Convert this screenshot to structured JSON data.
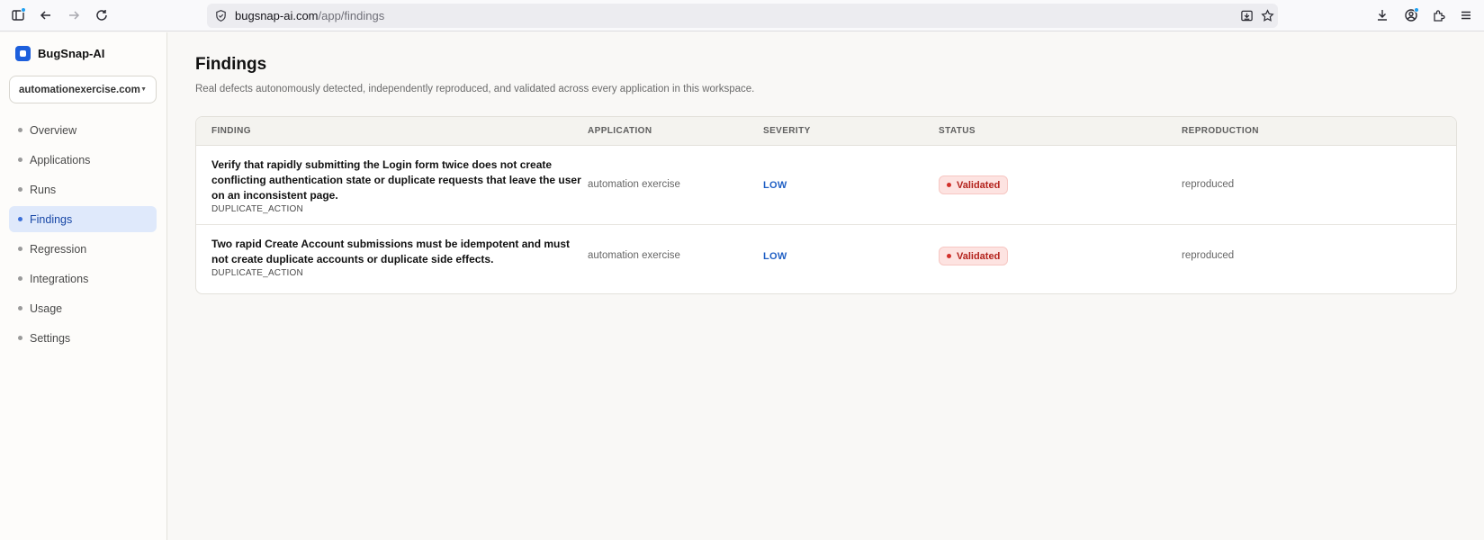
{
  "browser": {
    "url_host": "bugsnap-ai.com",
    "url_path": "/app/findings"
  },
  "sidebar": {
    "brand": "BugSnap-AI",
    "workspace": "automationexercise.com",
    "items": [
      {
        "label": "Overview",
        "active": false
      },
      {
        "label": "Applications",
        "active": false
      },
      {
        "label": "Runs",
        "active": false
      },
      {
        "label": "Findings",
        "active": true
      },
      {
        "label": "Regression",
        "active": false
      },
      {
        "label": "Integrations",
        "active": false
      },
      {
        "label": "Usage",
        "active": false
      },
      {
        "label": "Settings",
        "active": false
      }
    ]
  },
  "main": {
    "title": "Findings",
    "subtitle": "Real defects autonomously detected, independently reproduced, and validated across every application in this workspace.",
    "table": {
      "columns": [
        "FINDING",
        "APPLICATION",
        "SEVERITY",
        "STATUS",
        "REPRODUCTION"
      ],
      "rows": [
        {
          "title": "Verify that rapidly submitting the Login form twice does not create conflicting authentication state or duplicate requests that leave the user on an inconsistent page.",
          "type": "DUPLICATE_ACTION",
          "application": "automation exercise",
          "severity": "LOW",
          "status": "Validated",
          "reproduction": "reproduced"
        },
        {
          "title": "Two rapid Create Account submissions must be idempotent and must not create duplicate accounts or duplicate side effects.",
          "type": "DUPLICATE_ACTION",
          "application": "automation exercise",
          "severity": "LOW",
          "status": "Validated",
          "reproduction": "reproduced"
        }
      ]
    }
  },
  "colors": {
    "accent": "#1d5fdc",
    "active_nav_bg": "#dfe9fb",
    "status_validated_bg": "#fde3e1",
    "status_validated_text": "#b4231d",
    "severity_low": "#1f5fc4"
  },
  "icons": {
    "toolbar_left": [
      "sidebar-toggle-icon",
      "back-arrow-icon",
      "forward-arrow-icon",
      "reload-icon"
    ],
    "url_bar": [
      "shield-icon",
      "page-save-icon",
      "bookmark-star-icon"
    ],
    "toolbar_right": [
      "downloads-icon",
      "account-icon",
      "extensions-icon",
      "menu-icon"
    ]
  }
}
